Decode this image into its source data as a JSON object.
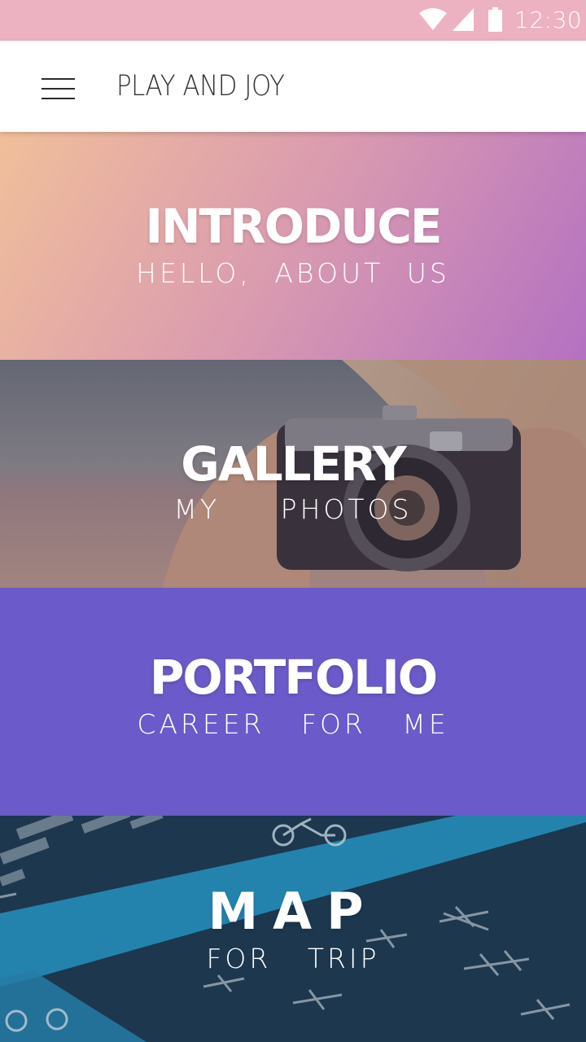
{
  "status_bar": {
    "time": "12:30",
    "icons": [
      "wifi-icon",
      "signal-icon",
      "battery-icon"
    ],
    "color": "#edb2c1"
  },
  "app_bar": {
    "title": "PLAY AND JOY",
    "menu_icon": "hamburger-menu-icon"
  },
  "sections": [
    {
      "title": "INTRODUCE",
      "subtitle": "HELLO, ABOUT US",
      "background": "pink-purple-gradient"
    },
    {
      "title": "GALLERY",
      "subtitle": "MY PHOTOS",
      "background": "photo-camera"
    },
    {
      "title": "PORTFOLIO",
      "subtitle": "CAREER FOR ME",
      "background": "#6b5ac9"
    },
    {
      "title": "MAP",
      "subtitle": "FOR TRIP",
      "background": "photo-bike-lane"
    }
  ],
  "colors": {
    "accent": "#6b5ac9",
    "status": "#edb2c1",
    "gradient_start": "#f1bf9a",
    "gradient_end": "#b471c2"
  }
}
